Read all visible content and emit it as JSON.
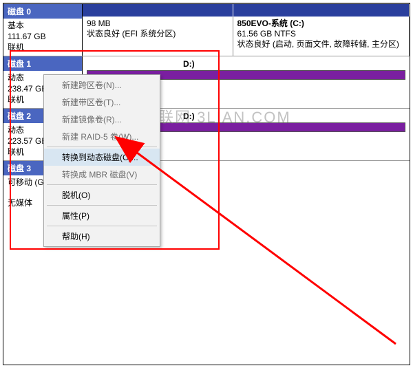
{
  "watermark": "联网  3LIAN.COM",
  "disks": {
    "d0": {
      "title": "磁盘 0",
      "type": "基本",
      "size": "111.67 GB",
      "status": "联机",
      "vol_a": {
        "size": "98 MB",
        "note": "状态良好 (EFI 系统分区)"
      },
      "vol_b": {
        "title": "850EVO-系统 (C:)",
        "size": "61.56 GB NTFS",
        "note": "状态良好 (启动, 页面文件, 故障转储, 主分区)"
      }
    },
    "d1": {
      "title": "磁盘 1",
      "type": "动态",
      "size": "238.47 GB",
      "status": "联机",
      "vol_a": {
        "label": "D:)"
      }
    },
    "d2": {
      "title": "磁盘 2",
      "type": "动态",
      "size": "223.57 GB",
      "status": "联机",
      "vol_a": {
        "label": "D:)"
      }
    },
    "d3": {
      "title": "磁盘 3",
      "type": "可移动 (G:)",
      "status": "无媒体"
    }
  },
  "menu": {
    "i0": "新建跨区卷(N)...",
    "i1": "新建带区卷(T)...",
    "i2": "新建镜像卷(R)...",
    "i3": "新建 RAID-5 卷(W)...",
    "i4": "转换到动态磁盘(C)...",
    "i5": "转换成 MBR 磁盘(V)",
    "i6": "脱机(O)",
    "i7": "属性(P)",
    "i8": "帮助(H)"
  }
}
